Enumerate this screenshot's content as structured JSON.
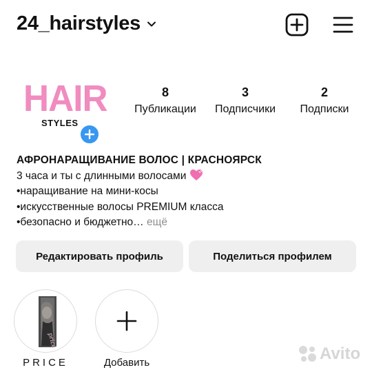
{
  "header": {
    "username": "24_hairstyles",
    "icons": [
      "chevron-down-icon",
      "new-post-icon",
      "menu-icon"
    ]
  },
  "profile": {
    "logo_main": "HAIR",
    "logo_sub": "STYLES"
  },
  "stats": [
    {
      "value": "8",
      "label": "Публикации"
    },
    {
      "value": "3",
      "label": "Подписчики"
    },
    {
      "value": "2",
      "label": "Подписки"
    }
  ],
  "bio": {
    "name": "АФРОНАРАЩИВАНИЕ ВОЛОС | КРАСНОЯРСК",
    "line1": "3 часа и ты с длинными волосами",
    "line2": "•наращивание на мини-косы",
    "line3": "•искусственные волосы PREMIUM класса",
    "line4": "•безопасно и бюджетно…",
    "more": "ещё"
  },
  "buttons": {
    "edit": "Редактировать профиль",
    "share": "Поделиться профилем"
  },
  "highlights": [
    {
      "label": "PRICE"
    },
    {
      "label": "Добавить"
    }
  ],
  "watermark": {
    "text": "Avito"
  },
  "colors": {
    "logo_pink": "#f08cc0",
    "add_blue": "#3897f0",
    "button_bg": "#efefef",
    "more_gray": "#8e8e8e"
  }
}
